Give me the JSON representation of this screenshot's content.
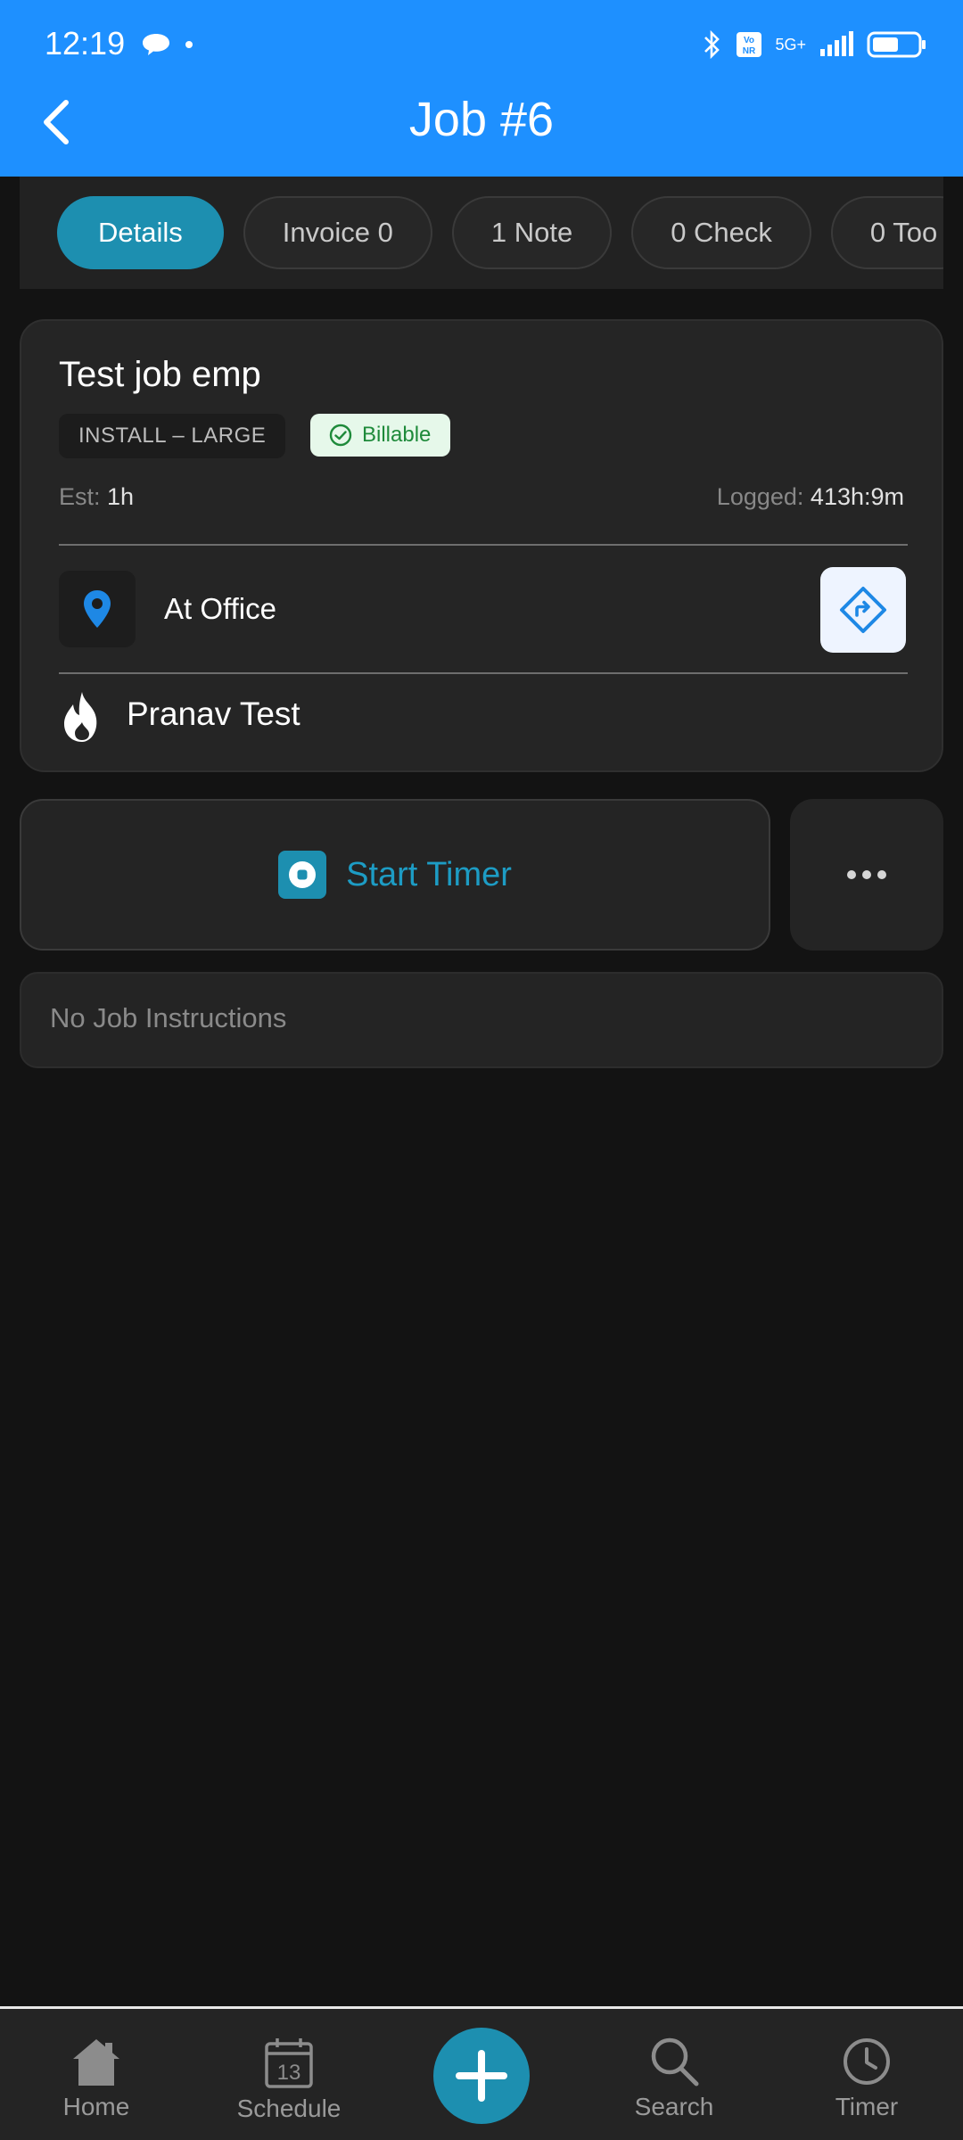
{
  "status_bar": {
    "time": "12:19",
    "network": "5G+",
    "volte": "Vo NR"
  },
  "header": {
    "title": "Job #6"
  },
  "tabs": [
    {
      "label": "Details",
      "active": true
    },
    {
      "label": "Invoice 0",
      "active": false
    },
    {
      "label": "1 Note",
      "active": false
    },
    {
      "label": "0 Check",
      "active": false
    },
    {
      "label": "0 Too",
      "active": false
    }
  ],
  "job": {
    "title": "Test job emp",
    "type": "INSTALL – LARGE",
    "billable_label": "Billable",
    "est_label": "Est:",
    "est_value": "1h",
    "logged_label": "Logged:",
    "logged_value": "413h:9m",
    "location": "At Office",
    "assignee": "Pranav Test"
  },
  "actions": {
    "start_timer": "Start Timer"
  },
  "instructions": {
    "text": "No Job Instructions"
  },
  "bottom_nav": {
    "home": "Home",
    "schedule": "Schedule",
    "schedule_day": "13",
    "search": "Search",
    "timer": "Timer"
  },
  "colors": {
    "header_bg": "#1e90ff",
    "accent": "#1d8fb0",
    "billable_text": "#1e8a3a",
    "billable_bg": "#e6f8ea",
    "location_pin": "#1e88e5"
  }
}
